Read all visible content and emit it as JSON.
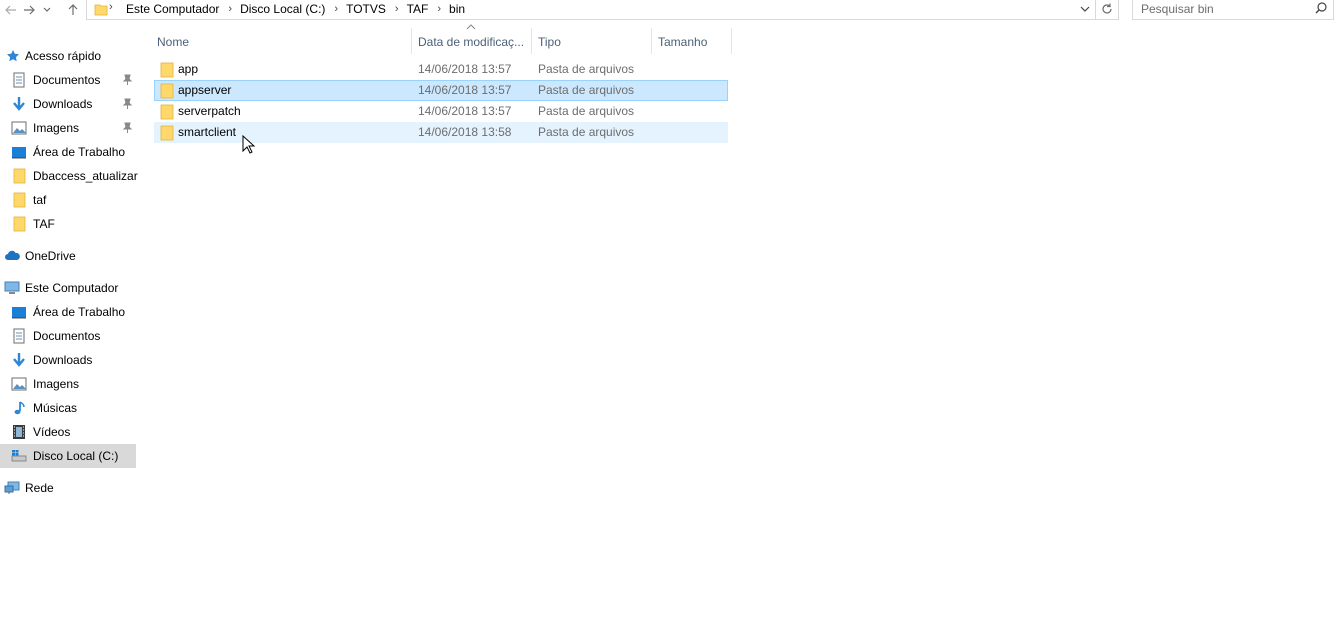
{
  "address_bar": {
    "breadcrumbs": [
      "Este Computador",
      "Disco Local (C:)",
      "TOTVS",
      "TAF",
      "bin"
    ]
  },
  "search": {
    "placeholder": "Pesquisar bin"
  },
  "nav_pane": {
    "quick_access": "Acesso rápido",
    "quick_items": [
      {
        "label": "Documentos",
        "icon": "documents-icon",
        "pinned": true
      },
      {
        "label": "Downloads",
        "icon": "downloads-icon",
        "pinned": true
      },
      {
        "label": "Imagens",
        "icon": "pictures-icon",
        "pinned": true
      },
      {
        "label": "Área de Trabalho",
        "icon": "desktop-icon",
        "pinned": false
      },
      {
        "label": "Dbaccess_atualizar",
        "icon": "folder-icon",
        "pinned": false
      },
      {
        "label": "taf",
        "icon": "folder-icon",
        "pinned": false
      },
      {
        "label": "TAF",
        "icon": "folder-icon",
        "pinned": false
      }
    ],
    "onedrive": "OneDrive",
    "this_pc": "Este Computador",
    "pc_items": [
      {
        "label": "Área de Trabalho",
        "icon": "desktop-icon"
      },
      {
        "label": "Documentos",
        "icon": "documents-icon"
      },
      {
        "label": "Downloads",
        "icon": "downloads-icon"
      },
      {
        "label": "Imagens",
        "icon": "pictures-icon"
      },
      {
        "label": "Músicas",
        "icon": "music-icon"
      },
      {
        "label": "Vídeos",
        "icon": "videos-icon"
      },
      {
        "label": "Disco Local (C:)",
        "icon": "drive-icon",
        "selected": true
      }
    ],
    "network": "Rede"
  },
  "columns": {
    "name": "Nome",
    "date": "Data de modificaç...",
    "type": "Tipo",
    "size": "Tamanho"
  },
  "files": [
    {
      "name": "app",
      "date": "14/06/2018 13:57",
      "type": "Pasta de arquivos",
      "state": "normal"
    },
    {
      "name": "appserver",
      "date": "14/06/2018 13:57",
      "type": "Pasta de arquivos",
      "state": "selected"
    },
    {
      "name": "serverpatch",
      "date": "14/06/2018 13:57",
      "type": "Pasta de arquivos",
      "state": "normal"
    },
    {
      "name": "smartclient",
      "date": "14/06/2018 13:58",
      "type": "Pasta de arquivos",
      "state": "hover"
    }
  ],
  "colors": {
    "selected_bg": "#cce8ff",
    "selected_border": "#99d1ff",
    "hover_bg": "#e5f3ff",
    "folder": "#ffd86b",
    "header_text": "#4c607a"
  }
}
